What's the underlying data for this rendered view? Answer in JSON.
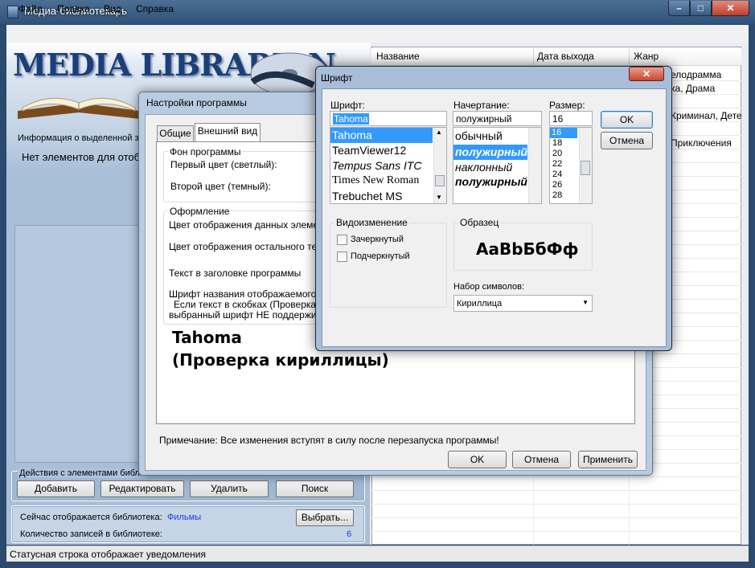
{
  "window": {
    "title": "Медиа-библиотекарь",
    "min": "–",
    "max": "□",
    "close": "✕"
  },
  "menu": [
    "Файл",
    "Правка",
    "Вид",
    "Справка"
  ],
  "left_panel": {
    "logo_text": "MEDIA LIBRARIAN",
    "info_label": "Информация о выделенной за",
    "no_items": "Нет элементов для отобр",
    "actions_title": "Действия с элементами библи",
    "buttons": {
      "add": "Добавить",
      "edit": "Редактировать",
      "delete": "Удалить",
      "search": "Поиск"
    },
    "library_label": "Сейчас отображается библиотека:",
    "library_name": "Фильмы",
    "choose_button": "Выбрать...",
    "count_label": "Количество записей в библиотеке:",
    "count_value": "6"
  },
  "status_bar": {
    "text": "Статусная строка отображает уведомления"
  },
  "list": {
    "columns": [
      "Название",
      "Дата выхода",
      "Жанр"
    ],
    "genre_cells": [
      "елодрамма",
      "ка, Драма",
      "",
      "Криминал, Дете",
      "",
      "Приключения"
    ]
  },
  "settings_dialog": {
    "title": "Настройки программы",
    "tabs": [
      "Общие",
      "Внешний вид"
    ],
    "bg_group": "Фон программы",
    "first_color": "Первый цвет (светлый):",
    "second_color": "Второй цвет (темный):",
    "design_group": "Оформление",
    "data_color": "Цвет отображения данных элемент",
    "other_color": "Цвет отображения остального текс",
    "header_text": "Текст в заголовке программы",
    "font_name_label": "Шрифт названия отображаемого эл",
    "hint_line1": "Если текст в скобках (Проверка к",
    "hint_line2": "выбранный шрифт НЕ поддерживае",
    "sample_line1": "Tahoma",
    "sample_line2": "(Проверка кириллицы)",
    "note": "Примечание: Все изменения вступят в силу после перезапуска программы!",
    "ok": "OK",
    "cancel": "Отмена",
    "apply": "Применить"
  },
  "font_dialog": {
    "title": "Шрифт",
    "font_label": "Шрифт:",
    "style_label": "Начертание:",
    "size_label": "Размер:",
    "font_value": "Tahoma",
    "style_value": "полужирный",
    "size_value": "16",
    "fonts": [
      "Tahoma",
      "TeamViewer12",
      "Tempus Sans ITC",
      "Times New Roman",
      "Trebuchet MS"
    ],
    "styles": [
      "обычный",
      "полужирный",
      "наклонный",
      "полужирный."
    ],
    "sizes": [
      "16",
      "18",
      "20",
      "22",
      "24",
      "26",
      "28"
    ],
    "ok": "OK",
    "cancel": "Отмена",
    "effects_group": "Видоизменение",
    "strike": "Зачеркнутый",
    "underline": "Подчеркнутый",
    "sample_group": "Образец",
    "sample_text": "AaBbБбФф",
    "charset_label": "Набор символов:",
    "charset_value": "Кириллица"
  }
}
